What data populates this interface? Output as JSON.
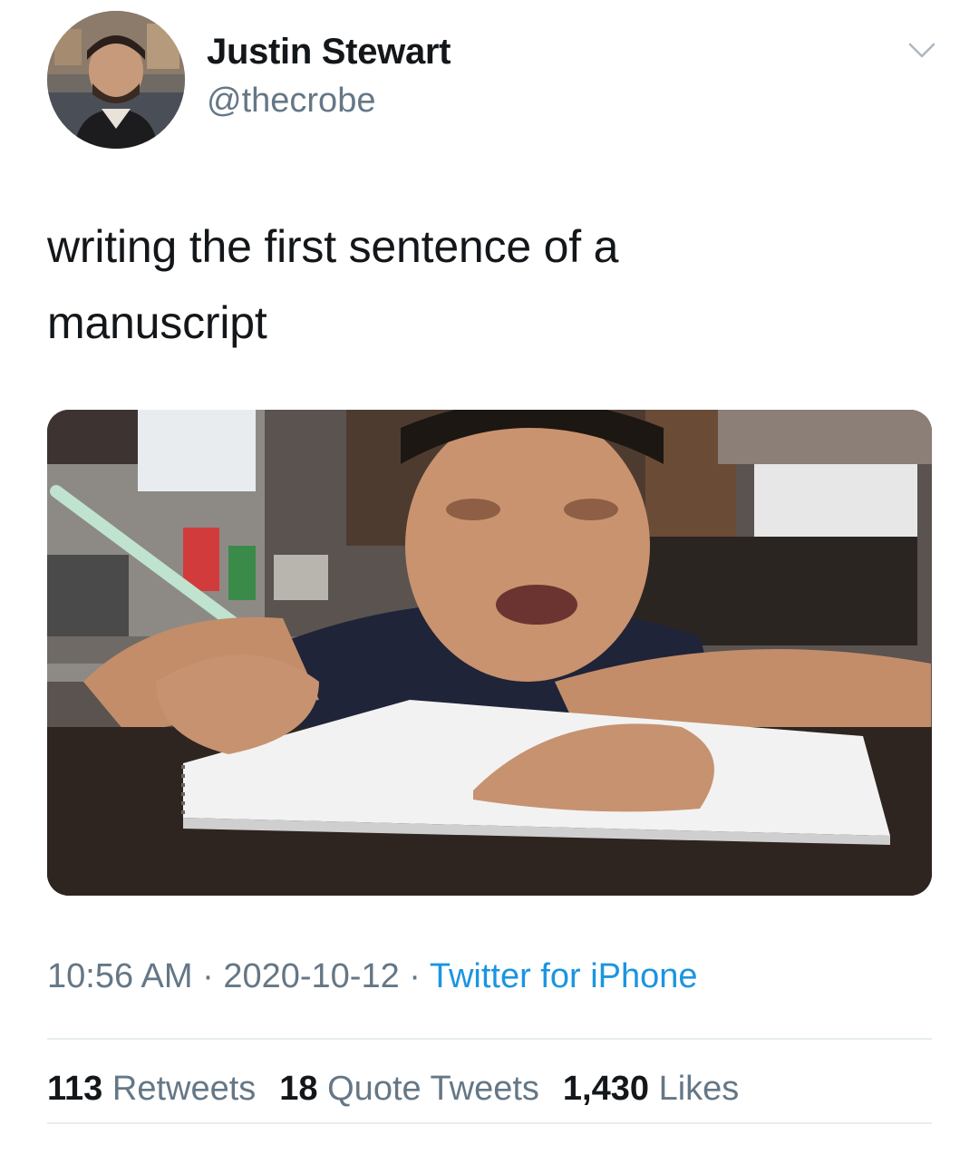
{
  "author": {
    "name": "Justin Stewart",
    "handle": "@thecrobe"
  },
  "tweet": {
    "text_line1": "writing the first sentence of a",
    "text_line2": "manuscript"
  },
  "meta": {
    "time": "10:56 AM",
    "separator": " · ",
    "date": "2020-10-12",
    "source": "Twitter for iPhone"
  },
  "stats": {
    "retweets_count": "113",
    "retweets_label": "Retweets",
    "quotes_count": "18",
    "quotes_label": "Quote Tweets",
    "likes_count": "1,430",
    "likes_label": "Likes"
  },
  "icons": {
    "menu": "chevron-down-icon"
  },
  "colors": {
    "text_primary": "#14171a",
    "text_secondary": "#657786",
    "link": "#1b95e0",
    "divider": "#e6ecf0"
  }
}
